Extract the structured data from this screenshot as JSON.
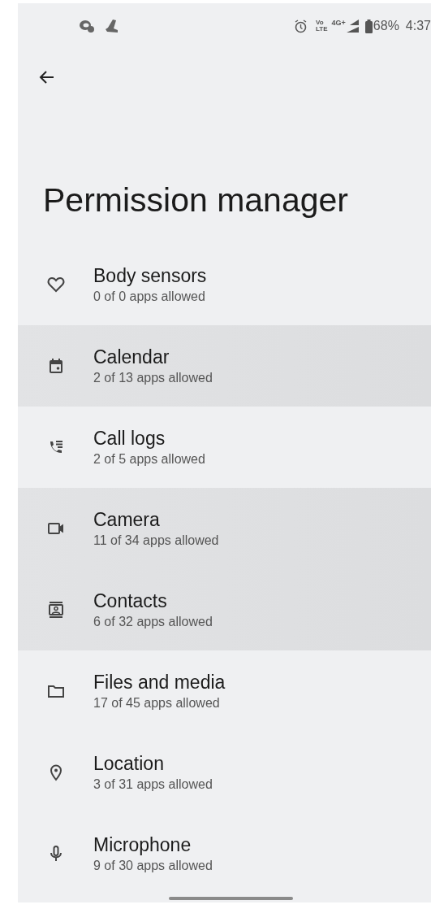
{
  "status_bar": {
    "volte": [
      "Vo",
      "LTE"
    ],
    "network": "4G+",
    "battery": "68%",
    "time": "4:37"
  },
  "title": "Permission manager",
  "permissions": [
    {
      "kind": "heart",
      "label": "Body sensors",
      "detail": "0 of 0 apps allowed",
      "highlighted": false
    },
    {
      "kind": "calendar",
      "label": "Calendar",
      "detail": "2 of 13 apps allowed",
      "highlighted": true
    },
    {
      "kind": "calllog",
      "label": "Call logs",
      "detail": "2 of 5 apps allowed",
      "highlighted": false
    },
    {
      "kind": "camera",
      "label": "Camera",
      "detail": "11 of 34 apps allowed",
      "highlighted": true
    },
    {
      "kind": "contacts",
      "label": "Contacts",
      "detail": "6 of 32 apps allowed",
      "highlighted": true
    },
    {
      "kind": "folder",
      "label": "Files and media",
      "detail": "17 of 45 apps allowed",
      "highlighted": false
    },
    {
      "kind": "location",
      "label": "Location",
      "detail": "3 of 31 apps allowed",
      "highlighted": false
    },
    {
      "kind": "mic",
      "label": "Microphone",
      "detail": "9 of 30 apps allowed",
      "highlighted": false
    }
  ]
}
